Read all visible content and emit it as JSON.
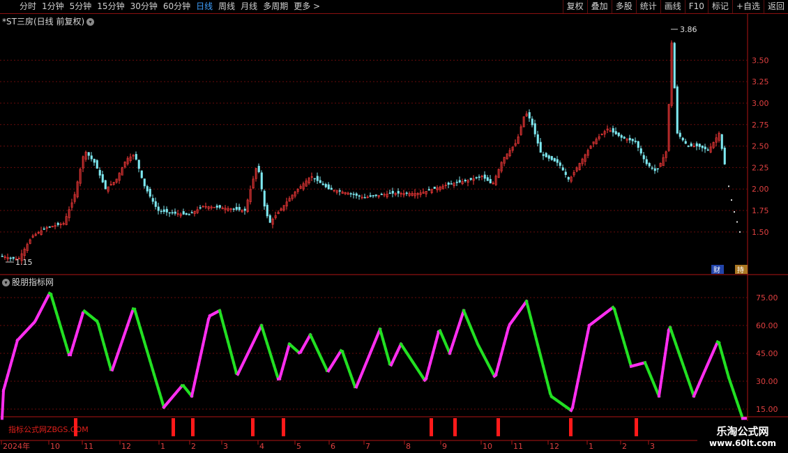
{
  "toolbar": {
    "timeframes": [
      "分时",
      "1分钟",
      "5分钟",
      "15分钟",
      "30分钟",
      "60分钟",
      "日线",
      "周线",
      "月线",
      "多周期",
      "更多"
    ],
    "active": "日线",
    "more_suffix": ">",
    "right": [
      "复权",
      "叠加",
      "多股",
      "统计",
      "画线",
      "F10",
      "标记",
      "+自选",
      "返回"
    ]
  },
  "stock": {
    "title": "*ST三房(日线 前复权)",
    "high_label": "3.86",
    "low_label": "1.15",
    "price_ticks": [
      "3.50",
      "3.25",
      "3.00",
      "2.75",
      "2.50",
      "2.25",
      "2.00",
      "1.75",
      "1.50"
    ],
    "tags": [
      "财",
      "持"
    ]
  },
  "indicator": {
    "title": "股朋指标网",
    "ticks": [
      "75.00",
      "60.00",
      "45.00",
      "30.00",
      "15.00"
    ],
    "watermark": "指标公式网ZBGS.COM"
  },
  "xaxis": [
    "2024年",
    "10",
    "11",
    "12",
    "1",
    "2",
    "3",
    "4",
    "5",
    "6",
    "7",
    "8",
    "9",
    "10",
    "11",
    "12",
    "1",
    "2",
    "3"
  ],
  "site": {
    "name": "乐淘公式网",
    "url": "www.60lt.com"
  },
  "colors": {
    "up": "#ff3b3b",
    "down": "#7ee8f0",
    "rise": "#ff2ef0",
    "fall": "#22e022",
    "signal": "#ff1a1a",
    "grid": "#6a0c0c"
  },
  "chart_data": {
    "type": "candlestick+line",
    "price_range": [
      1.15,
      3.86
    ],
    "price_path": [
      [
        0,
        1.22
      ],
      [
        25,
        1.18
      ],
      [
        45,
        1.45
      ],
      [
        65,
        1.55
      ],
      [
        90,
        1.6
      ],
      [
        105,
        1.9
      ],
      [
        120,
        2.45
      ],
      [
        135,
        2.3
      ],
      [
        150,
        2.0
      ],
      [
        165,
        2.1
      ],
      [
        180,
        2.35
      ],
      [
        192,
        2.4
      ],
      [
        205,
        2.05
      ],
      [
        225,
        1.75
      ],
      [
        245,
        1.72
      ],
      [
        270,
        1.7
      ],
      [
        290,
        1.8
      ],
      [
        320,
        1.78
      ],
      [
        350,
        1.75
      ],
      [
        368,
        2.3
      ],
      [
        378,
        1.8
      ],
      [
        385,
        1.6
      ],
      [
        400,
        1.75
      ],
      [
        420,
        1.95
      ],
      [
        445,
        2.15
      ],
      [
        470,
        2.0
      ],
      [
        500,
        1.95
      ],
      [
        520,
        1.9
      ],
      [
        560,
        1.95
      ],
      [
        600,
        1.95
      ],
      [
        640,
        2.05
      ],
      [
        670,
        2.1
      ],
      [
        690,
        2.15
      ],
      [
        705,
        2.05
      ],
      [
        720,
        2.35
      ],
      [
        740,
        2.55
      ],
      [
        752,
        2.9
      ],
      [
        760,
        2.8
      ],
      [
        775,
        2.4
      ],
      [
        800,
        2.3
      ],
      [
        815,
        2.1
      ],
      [
        830,
        2.3
      ],
      [
        850,
        2.55
      ],
      [
        870,
        2.7
      ],
      [
        890,
        2.6
      ],
      [
        910,
        2.55
      ],
      [
        925,
        2.3
      ],
      [
        940,
        2.2
      ],
      [
        955,
        2.45
      ],
      [
        962,
        3.7
      ],
      [
        970,
        2.65
      ],
      [
        985,
        2.5
      ],
      [
        1000,
        2.5
      ],
      [
        1015,
        2.45
      ],
      [
        1030,
        2.65
      ],
      [
        1040,
        2.2
      ],
      [
        1050,
        1.8
      ],
      [
        1062,
        1.45
      ]
    ],
    "indicator_path": [
      [
        5,
        25
      ],
      [
        25,
        52
      ],
      [
        50,
        62
      ],
      [
        72,
        78
      ],
      [
        100,
        43
      ],
      [
        120,
        68
      ],
      [
        140,
        62
      ],
      [
        160,
        35
      ],
      [
        192,
        70
      ],
      [
        235,
        16
      ],
      [
        262,
        28
      ],
      [
        275,
        22
      ],
      [
        300,
        65
      ],
      [
        315,
        68
      ],
      [
        340,
        33
      ],
      [
        375,
        60
      ],
      [
        400,
        30
      ],
      [
        415,
        50
      ],
      [
        430,
        45
      ],
      [
        445,
        55
      ],
      [
        470,
        35
      ],
      [
        490,
        47
      ],
      [
        510,
        26
      ],
      [
        545,
        58
      ],
      [
        560,
        38
      ],
      [
        575,
        50
      ],
      [
        610,
        30
      ],
      [
        630,
        58
      ],
      [
        645,
        45
      ],
      [
        665,
        68
      ],
      [
        685,
        50
      ],
      [
        710,
        32
      ],
      [
        730,
        60
      ],
      [
        755,
        73
      ],
      [
        790,
        22
      ],
      [
        820,
        14
      ],
      [
        845,
        60
      ],
      [
        880,
        70
      ],
      [
        905,
        38
      ],
      [
        925,
        40
      ],
      [
        945,
        22
      ],
      [
        960,
        60
      ],
      [
        995,
        22
      ],
      [
        1010,
        35
      ],
      [
        1030,
        52
      ],
      [
        1045,
        32
      ],
      [
        1065,
        10
      ]
    ],
    "signals_x": [
      108,
      248,
      276,
      362,
      406,
      618,
      652,
      714,
      818,
      912
    ]
  }
}
